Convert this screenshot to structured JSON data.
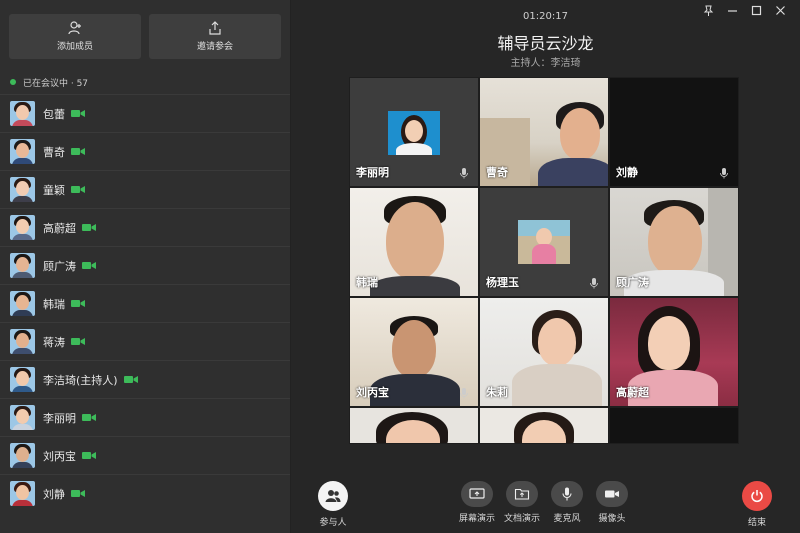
{
  "sidebar": {
    "add_member_label": "添加成员",
    "invite_label": "邀请参会",
    "status_text": "已在会议中 · 57",
    "members": [
      {
        "name": "包蕾"
      },
      {
        "name": "曹奇"
      },
      {
        "name": "童颖"
      },
      {
        "name": "高蔚超"
      },
      {
        "name": "顾广涛"
      },
      {
        "name": "韩瑞"
      },
      {
        "name": "蒋涛"
      },
      {
        "name": "李洁琦(主持人)"
      },
      {
        "name": "李丽明"
      },
      {
        "name": "刘丙宝"
      },
      {
        "name": "刘静"
      }
    ]
  },
  "header": {
    "timer": "01:20:17",
    "title": "辅导员云沙龙",
    "host": "主持人：李洁琦"
  },
  "grid": {
    "tiles": [
      {
        "name": "李丽明"
      },
      {
        "name": "曹奇"
      },
      {
        "name": "刘静"
      },
      {
        "name": "韩瑞"
      },
      {
        "name": "杨理玉"
      },
      {
        "name": "顾广涛"
      },
      {
        "name": "刘丙宝"
      },
      {
        "name": "朱莉"
      },
      {
        "name": "高蔚超"
      }
    ]
  },
  "toolbar": {
    "participants_label": "参与人",
    "screen_share_label": "屏幕演示",
    "doc_share_label": "文档演示",
    "mic_label": "麦克风",
    "camera_label": "摄像头",
    "end_label": "结束"
  },
  "colors": {
    "accent_green": "#3dbb5a",
    "end_red": "#ea4a45"
  }
}
